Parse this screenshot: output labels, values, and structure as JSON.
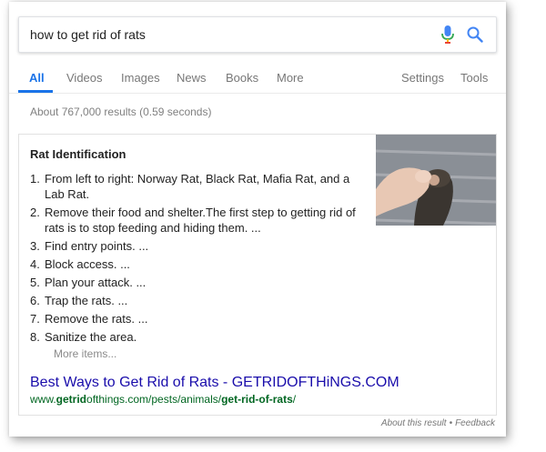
{
  "search": {
    "query": "how to get rid of rats"
  },
  "tabs": [
    {
      "label": "All"
    },
    {
      "label": "Videos"
    },
    {
      "label": "Images"
    },
    {
      "label": "News"
    },
    {
      "label": "Books"
    },
    {
      "label": "More"
    },
    {
      "label": "Settings"
    },
    {
      "label": "Tools"
    }
  ],
  "stats": "About 767,000 results (0.59 seconds)",
  "snippet": {
    "heading": "Rat Identification",
    "steps": [
      {
        "num": "1.",
        "text": "From left to right: Norway Rat, Black Rat, Mafia Rat, and a Lab Rat."
      },
      {
        "num": "2.",
        "text": "Remove their food and shelter.The first step to getting rid of rats is to stop feeding and hiding them. ..."
      },
      {
        "num": "3.",
        "text": "Find entry points. ..."
      },
      {
        "num": "4.",
        "text": "Block access. ..."
      },
      {
        "num": "5.",
        "text": "Plan your attack. ..."
      },
      {
        "num": "6.",
        "text": "Trap the rats. ..."
      },
      {
        "num": "7.",
        "text": "Remove the rats. ..."
      },
      {
        "num": "8.",
        "text": "Sanitize the area."
      }
    ],
    "more_items": "More items...",
    "title": "Best Ways to Get Rid of Rats - GETRIDOFTHiNGS.COM",
    "url": {
      "p1": "www.",
      "p2": "getrid",
      "p3": "ofthings.com/pests/animals/",
      "p4": "get-rid-of-rats",
      "p5": "/"
    }
  },
  "footer": {
    "about": "About this result",
    "sep": "•",
    "feedback": "Feedback"
  },
  "colors": {
    "accent": "#1a73e8",
    "link": "#1a0dab",
    "url": "#006621"
  }
}
